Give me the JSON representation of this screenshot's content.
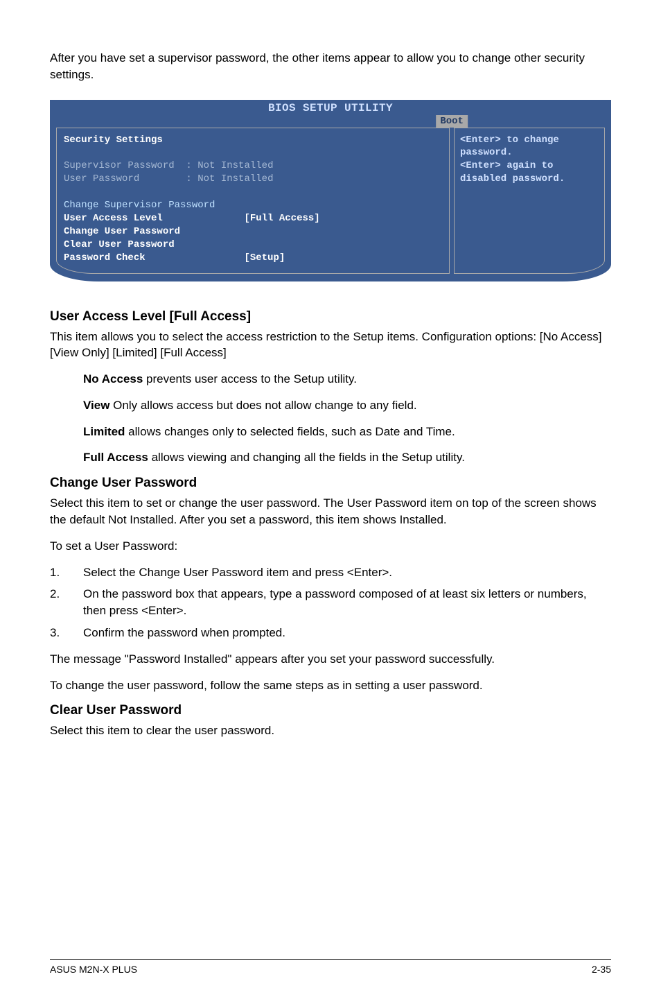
{
  "intro": "After you have set a supervisor password, the other items appear to allow you to change other security settings.",
  "bios": {
    "title": "BIOS SETUP UTILITY",
    "tab": "Boot",
    "left": {
      "heading": "Security Settings",
      "sup_label": "Supervisor Password  :",
      "sup_value": "Not Installed",
      "user_label": "User Password        :",
      "user_value": "Not Installed",
      "change_sup": "Change Supervisor Password",
      "ual_label": "User Access Level",
      "ual_value": "[Full Access]",
      "cup": "Change User Password",
      "clup": "Clear User Password",
      "pw_label": "Password Check",
      "pw_value": "[Setup]"
    },
    "right": "<Enter> to change password.\n<Enter> again to disabled password."
  },
  "sec1": {
    "heading": "User Access Level [Full Access]",
    "p1": "This item allows you to select the access restriction to the Setup items. Configuration options: [No Access] [View Only] [Limited] [Full Access]",
    "b1_bold": "No Access",
    "b1_rest": " prevents user access to the Setup utility.",
    "b2_bold": "View",
    "b2_rest": " Only allows access but does not allow change to any field.",
    "b3_bold": "Limited",
    "b3_rest": " allows changes only to selected fields, such as Date and Time.",
    "b4_bold": "Full Access",
    "b4_rest": " allows viewing and changing all the fields in the Setup utility."
  },
  "sec2": {
    "heading": "Change User Password",
    "p1": "Select this item to set or change the user password. The User Password item on top of the screen shows the default Not Installed. After you set a password, this item shows Installed.",
    "p2": "To set a User Password:",
    "li1": "Select the Change User Password item and press <Enter>.",
    "li2": "On the password box that appears, type a password composed of at least six letters or numbers, then press <Enter>.",
    "li3": "Confirm the password when prompted.",
    "p3": "The message \"Password Installed\" appears after you set your password successfully.",
    "p4": "To change the user password, follow the same steps as in setting a user password."
  },
  "sec3": {
    "heading": "Clear User Password",
    "p1": "Select this item to clear the user password."
  },
  "footer": {
    "left": "ASUS M2N-X PLUS",
    "right": "2-35"
  }
}
